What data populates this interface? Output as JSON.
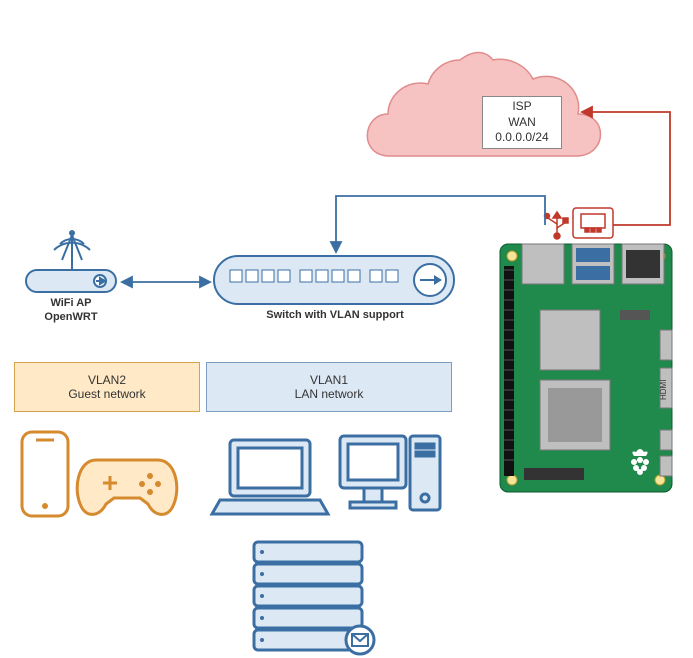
{
  "cloud": {
    "line1": "ISP",
    "line2": "WAN",
    "line3": "0.0.0.0/24"
  },
  "wifi": {
    "line1": "WiFi AP",
    "line2": "OpenWRT"
  },
  "switch": {
    "label": "Switch with VLAN support"
  },
  "vlan2": {
    "title": "VLAN2",
    "sub": "Guest network"
  },
  "vlan1": {
    "title": "VLAN1",
    "sub": "LAN network"
  },
  "colors": {
    "blue": "#3b6fa3",
    "bluefill": "#dde8f5",
    "orange": "#d68a2e",
    "orangefill": "#ffe9c7",
    "cloud": "#f6c2c2",
    "cloudstroke": "#e18c8c",
    "red": "#c0392b"
  }
}
